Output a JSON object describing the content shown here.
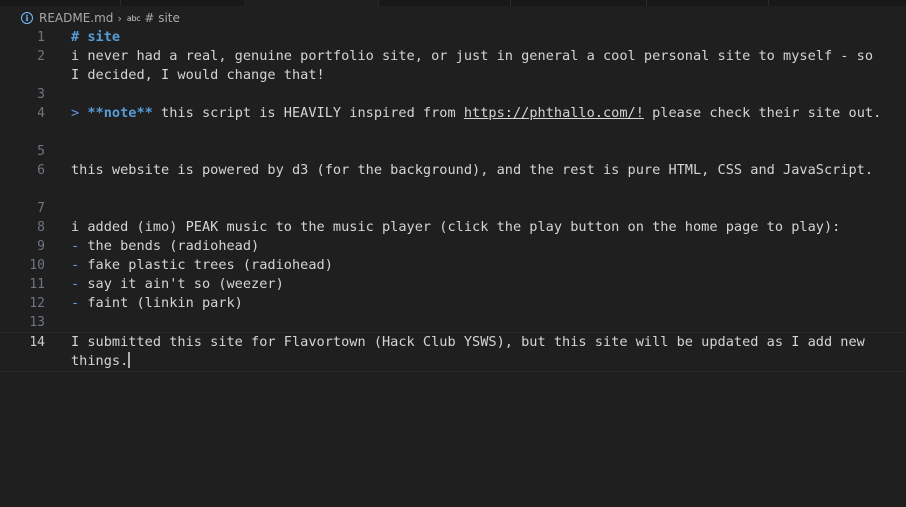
{
  "breadcrumb": {
    "file": "README.md",
    "symbol_prefix": "abc",
    "symbol": "# site"
  },
  "editor": {
    "lines": [
      {
        "num": "1"
      },
      {
        "num": "2"
      },
      {
        "num": "3"
      },
      {
        "num": "4"
      },
      {
        "num": "5"
      },
      {
        "num": "6"
      },
      {
        "num": "7"
      },
      {
        "num": "8"
      },
      {
        "num": "9"
      },
      {
        "num": "10"
      },
      {
        "num": "11"
      },
      {
        "num": "12"
      },
      {
        "num": "13"
      },
      {
        "num": "14"
      }
    ],
    "line1": {
      "marker": "#",
      "text": " site"
    },
    "line2": {
      "text": "i never had a real, genuine portfolio site, or just in general a cool personal site to myself - so I decided, I would change that!"
    },
    "line4": {
      "quote": ">",
      "bold": " **note**",
      "pre": " this script is HEAVILY inspired from ",
      "link": "https://phthallo.com/!",
      "post": " please check their site out."
    },
    "line6": {
      "text": "this website is powered by d3 (for the background), and the rest is pure HTML, CSS and JavaScript."
    },
    "line8": {
      "text": "i added (imo) PEAK music to the music player (click the play button on the home page to play):"
    },
    "line9": {
      "dash": "-",
      "text": " the bends (radiohead)"
    },
    "line10": {
      "dash": "-",
      "text": " fake plastic trees (radiohead)"
    },
    "line11": {
      "dash": "-",
      "text": " say it ain't so (weezer)"
    },
    "line12": {
      "dash": "-",
      "text": " faint (linkin park)"
    },
    "line14": {
      "text": "I submitted this site for Flavortown (Hack Club YSWS), but this site will be updated as I add new things."
    }
  },
  "colors": {
    "background": "#1f1f1f",
    "heading": "#569cd6",
    "text": "#d4d4d4",
    "line_number": "#6e7681",
    "info_icon": "#75beff"
  }
}
